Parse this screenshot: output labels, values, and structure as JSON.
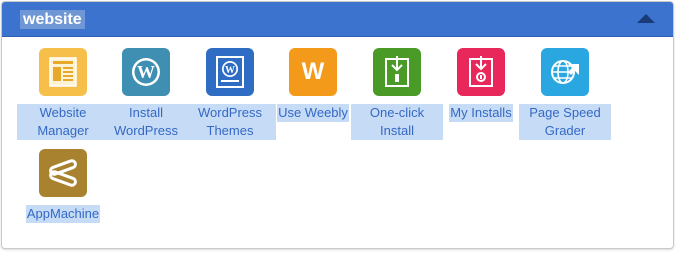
{
  "panel": {
    "title": "website",
    "collapse_icon": "triangle-up-icon",
    "colors": {
      "header": "#3b73cf",
      "label_text": "#3568c4",
      "selection": "#c6dcf6"
    }
  },
  "apps": [
    {
      "key": "website-manager",
      "label": "Website Manager",
      "icon": "document-page-icon",
      "color": "#f5bf4a"
    },
    {
      "key": "install-wordpress",
      "label": "Install WordPress",
      "icon": "wordpress-icon",
      "color": "#3f8fb3"
    },
    {
      "key": "wordpress-themes",
      "label": "WordPress Themes",
      "icon": "wordpress-theme-icon",
      "color": "#2f6dc4"
    },
    {
      "key": "use-weebly",
      "label": "Use Weebly",
      "icon": "weebly-icon",
      "color": "#f39a1a",
      "glyph": "W"
    },
    {
      "key": "one-click-install",
      "label": "One-click Install",
      "icon": "download-install-icon",
      "color": "#4a9a28"
    },
    {
      "key": "my-installs",
      "label": "My Installs",
      "icon": "my-installs-icon",
      "color": "#e8275a"
    },
    {
      "key": "page-speed-grader",
      "label": "Page Speed Grader",
      "icon": "globe-arrow-icon",
      "color": "#2aa7e0"
    },
    {
      "key": "appmachine",
      "label": "AppMachine",
      "icon": "appmachine-icon",
      "color": "#a8822e"
    }
  ]
}
